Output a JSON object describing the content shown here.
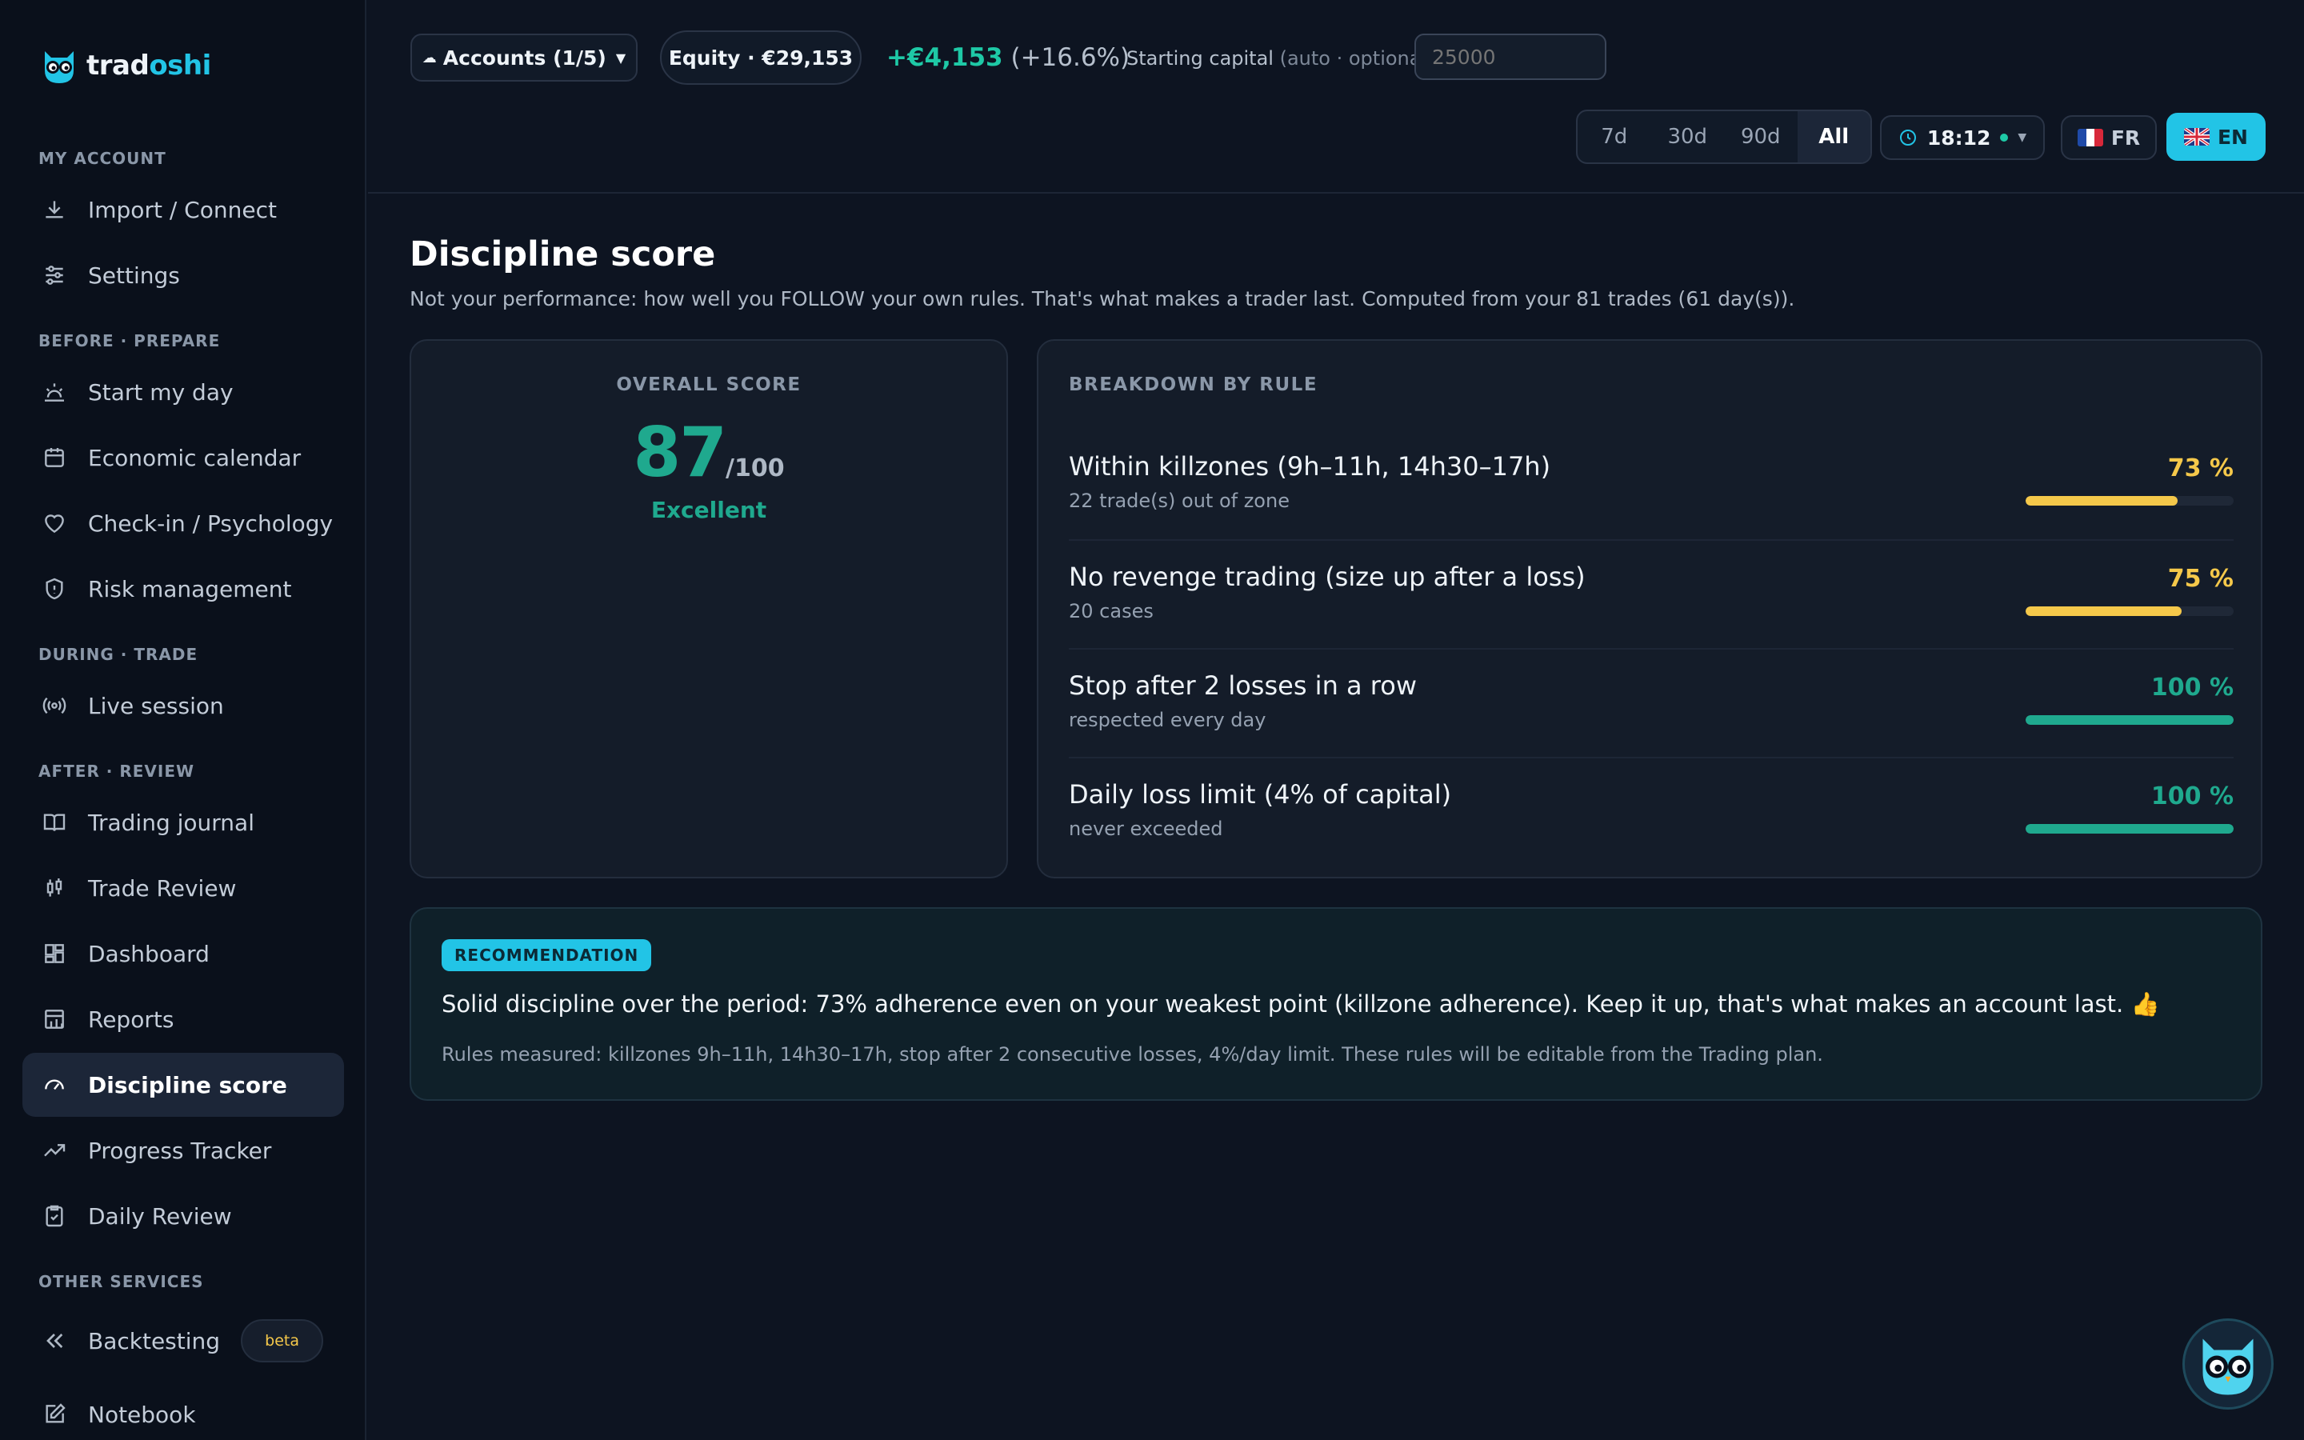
{
  "brand": {
    "name_part1": "trad",
    "name_part2": "oshi"
  },
  "sidebar": {
    "sections": [
      {
        "label": "MY ACCOUNT"
      },
      {
        "label": "BEFORE · PREPARE"
      },
      {
        "label": "DURING · TRADE"
      },
      {
        "label": "AFTER · REVIEW"
      },
      {
        "label": "OTHER SERVICES"
      }
    ],
    "items": [
      {
        "label": "Import / Connect",
        "icon": "download-icon"
      },
      {
        "label": "Settings",
        "icon": "sliders-icon"
      },
      {
        "label": "Start my day",
        "icon": "sunrise-icon"
      },
      {
        "label": "Economic calendar",
        "icon": "calendar-icon"
      },
      {
        "label": "Check-in / Psychology",
        "icon": "heart-icon"
      },
      {
        "label": "Risk management",
        "icon": "shield-icon"
      },
      {
        "label": "Live session",
        "icon": "broadcast-icon"
      },
      {
        "label": "Trading journal",
        "icon": "book-icon"
      },
      {
        "label": "Trade Review",
        "icon": "candlestick-icon"
      },
      {
        "label": "Dashboard",
        "icon": "dashboard-icon"
      },
      {
        "label": "Reports",
        "icon": "report-icon"
      },
      {
        "label": "Discipline score",
        "icon": "gauge-icon",
        "active": true
      },
      {
        "label": "Progress Tracker",
        "icon": "trending-up-icon"
      },
      {
        "label": "Daily Review",
        "icon": "clipboard-check-icon"
      },
      {
        "label": "Backtesting",
        "icon": "rewind-icon",
        "badge": "beta"
      },
      {
        "label": "Notebook",
        "icon": "edit-icon"
      }
    ]
  },
  "topbar": {
    "accounts_label": "Accounts (1/5)",
    "equity_label": "Equity · €29,153",
    "pnl_value": "+€4,153",
    "pnl_percent": "(+16.6%)",
    "capital_label": "Starting capital",
    "capital_hint": "(auto · optional)",
    "capital_value": "25000",
    "ranges": [
      "7d",
      "30d",
      "90d",
      "All"
    ],
    "selected_range": "All",
    "clock": "18:12",
    "lang_fr": "FR",
    "lang_en": "EN",
    "accent": "#22c4e6"
  },
  "main": {
    "title": "Discipline score",
    "subtitle": "Not your performance: how well you FOLLOW your own rules. That's what makes a trader last. Computed from your 81 trades (61 day(s)).",
    "overall": {
      "label": "OVERALL SCORE",
      "score": "87",
      "denominator": "/100",
      "verdict": "Excellent"
    },
    "breakdown": {
      "label": "BREAKDOWN BY RULE",
      "rules": [
        {
          "title": "Within killzones (9h–11h, 14h30–17h)",
          "note": "22 trade(s) out of zone",
          "pct_label": "73 %",
          "value": 73,
          "color": "#f5c84a"
        },
        {
          "title": "No revenge trading (size up after a loss)",
          "note": "20 cases",
          "pct_label": "75 %",
          "value": 75,
          "color": "#f5c84a"
        },
        {
          "title": "Stop after 2 losses in a row",
          "note": "respected every day",
          "pct_label": "100 %",
          "value": 100,
          "color": "#1fa98e"
        },
        {
          "title": "Daily loss limit (4% of capital)",
          "note": "never exceeded",
          "pct_label": "100 %",
          "value": 100,
          "color": "#1fa98e"
        }
      ]
    },
    "recommendation": {
      "badge": "RECOMMENDATION",
      "text": "Solid discipline over the period: 73% adherence even on your weakest point (killzone adherence). Keep it up, that's what makes an account last. 👍",
      "note": "Rules measured: killzones 9h–11h, 14h30–17h, stop after 2 consecutive losses, 4%/day limit. These rules will be editable from the Trading plan."
    }
  }
}
